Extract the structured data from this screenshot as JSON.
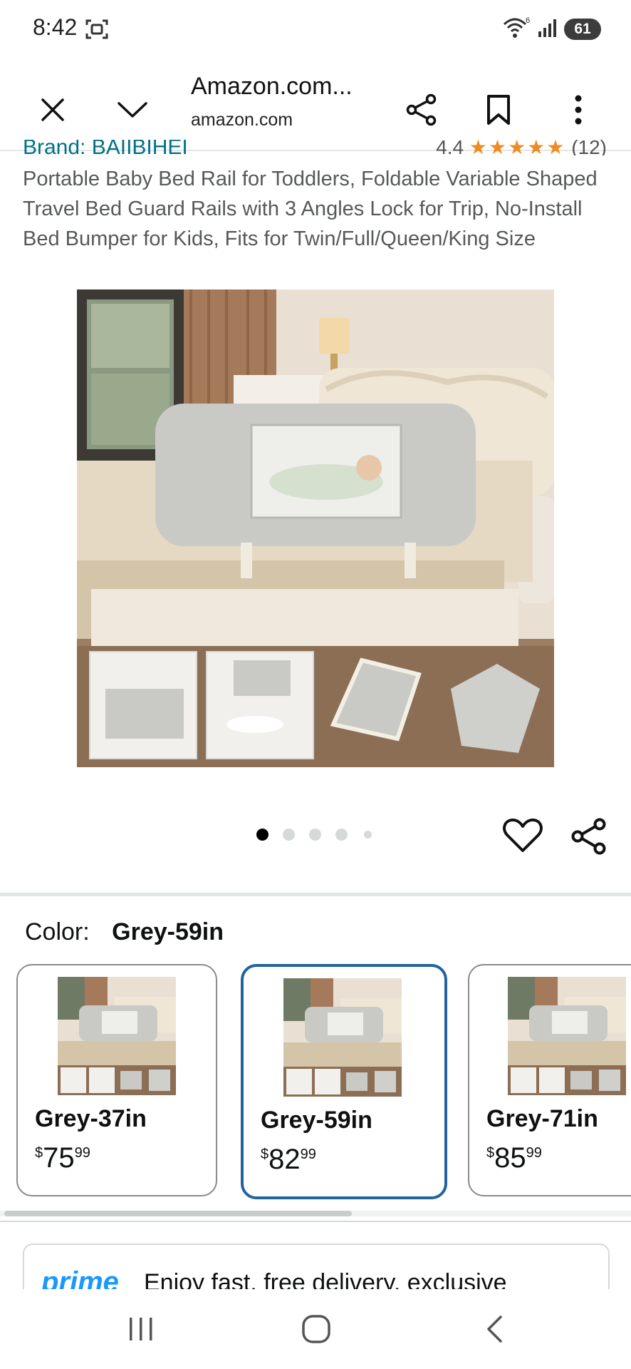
{
  "status_bar": {
    "time": "8:42",
    "battery": "61",
    "wifi_superscript": "6"
  },
  "browser": {
    "title": "Amazon.com...",
    "domain": "amazon.com"
  },
  "product": {
    "brand_cut": "Brand: BAIIBIHEI",
    "rating_cut": "4.4",
    "rating_count_cut": "(12)",
    "title": "Portable Baby Bed Rail for Toddlers, Foldable Variable Shaped Travel Bed Guard Rails with 3 Angles Lock for Trip, No-Install Bed Bumper for Kids, Fits for Twin/Full/Queen/King Size"
  },
  "carousel": {
    "total": 5,
    "active_index": 0
  },
  "color": {
    "label": "Color:",
    "selected": "Grey-59in"
  },
  "options": [
    {
      "name": "Grey-37in",
      "currency": "$",
      "whole": "75",
      "cents": "99",
      "selected": false
    },
    {
      "name": "Grey-59in",
      "currency": "$",
      "whole": "82",
      "cents": "99",
      "selected": true
    },
    {
      "name": "Grey-71in",
      "currency": "$",
      "whole": "85",
      "cents": "99",
      "selected": false
    }
  ],
  "prime": {
    "logo": "prime",
    "text": "Enjoy fast, free delivery, exclusive"
  },
  "colors": {
    "link": "#007185",
    "star": "#f08b22",
    "selected_border": "#2162a1",
    "prime_blue": "#1a98ff"
  }
}
